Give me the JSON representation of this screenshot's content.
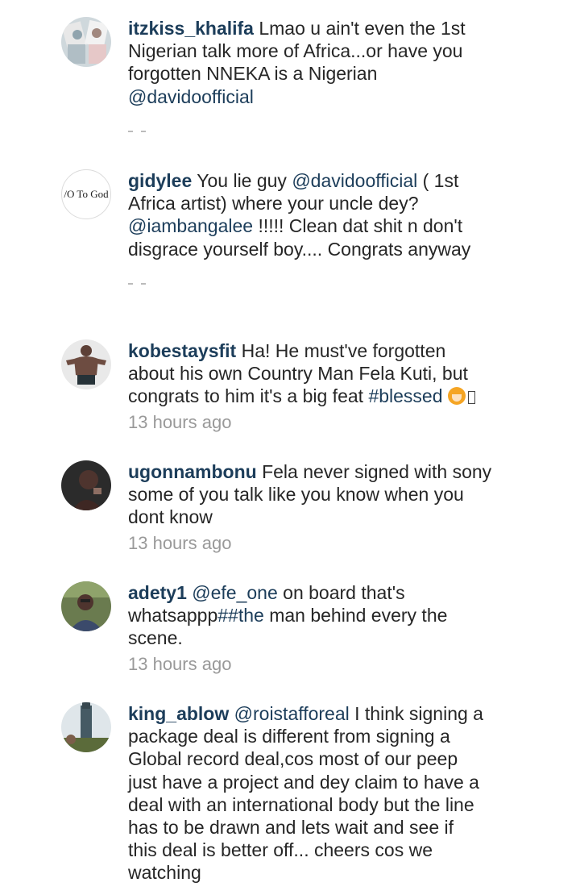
{
  "comments": [
    {
      "username": "itzkiss_khalifa",
      "lines": [
        "Lmao u ain't even the 1st",
        "Nigerian talk more of Africa...or have you",
        "forgotten NNEKA is a Nigerian"
      ],
      "mention": "@davidoofficial"
    },
    {
      "username": "gidylee",
      "avatar_text": "/O To God",
      "line1_a": "You lie guy ",
      "line1_mention": "@davidoofficial",
      "line1_b": " ( 1st",
      "line2": "Africa artist) where your uncle dey?",
      "line3_mention": "@iambangalee",
      "line3_b": " !!!!! Clean dat shit n don't",
      "line4": "disgrace yourself boy.... Congrats anyway"
    },
    {
      "username": "kobestaysfit",
      "lines": [
        "Ha! He must've forgotten",
        "about his own Country Man Fela Kuti, but"
      ],
      "line3_a": "congrats to him it's a big feat ",
      "hashtag": "#blessed",
      "time": "13 hours ago"
    },
    {
      "username": "ugonnambonu",
      "lines": [
        "Fela never signed with sony",
        "some of you talk like you know when you",
        "dont know"
      ],
      "time": "13 hours ago"
    },
    {
      "username": "adety1",
      "mention": "@efe_one",
      "line1_b": " on board that's",
      "line2_a": "whatsappp",
      "line2_tag": "##the",
      "line2_b": " man behind every the",
      "line3": "scene.",
      "time": "13 hours ago"
    },
    {
      "username": "king_ablow",
      "mention": "@roistafforeal",
      "line1_b": " I think signing a",
      "lines": [
        "package deal is different from signing a",
        "Global record deal,cos most of our peep",
        "just have a project and dey claim to have a",
        "deal with an international body but the line",
        "has to be drawn and lets wait and see if",
        "this deal is better off... cheers cos we",
        "watching"
      ]
    }
  ]
}
